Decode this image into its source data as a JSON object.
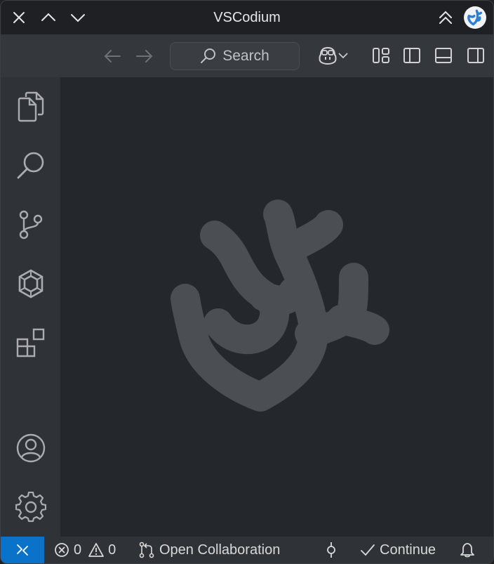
{
  "titlebar": {
    "title": "VSCodium",
    "icons": [
      "close-icon",
      "chevron-up-icon",
      "chevron-down-icon",
      "double-chevron-up-icon",
      "vscodium-logo"
    ]
  },
  "toolbar": {
    "search_label": "Search",
    "icons": [
      "arrow-left-icon",
      "arrow-right-icon",
      "search-icon",
      "copilot-icon",
      "chevron-down-icon",
      "customize-layout-icon",
      "toggle-primary-sidebar-icon",
      "toggle-panel-icon",
      "toggle-secondary-sidebar-icon"
    ]
  },
  "activitybar": {
    "items": [
      "files-icon",
      "search-icon",
      "source-control-icon",
      "gitpod-icon",
      "extensions-icon"
    ],
    "bottom": [
      "account-icon",
      "gear-icon"
    ]
  },
  "statusbar": {
    "errors": "0",
    "warnings": "0",
    "collaboration": "Open Collaboration",
    "continue": "Continue"
  },
  "colors": {
    "accent": "#0a73c9",
    "watermark": "#4b4e53",
    "background": "#24272b"
  }
}
